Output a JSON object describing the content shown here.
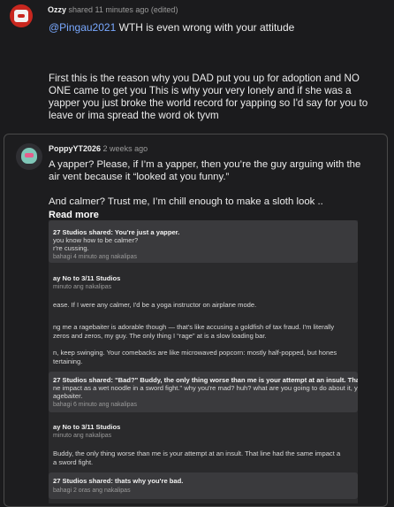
{
  "comment": {
    "username": "Ozzy",
    "shared": "shared 11 minutes ago (edited)",
    "mention": "@Pingau2021",
    "first_line": " WTH is even wrong with your attitude",
    "body_lines": [
      "First this is the reason why you DAD put you up for adoption and NO",
      "ONE came to get you This is why your very lonely and if she was a",
      "yapper you just broke the world record for yapping so I'd say for you to",
      "leave or ima spread the word ok tyvm"
    ]
  },
  "reply": {
    "username": "PoppyYT2026",
    "time": "2 weeks ago",
    "lines": [
      "A yapper? Please, if I’m a yapper, then you’re the guy arguing with the",
      "air vent because it “looked at you funny.”",
      "",
      "And calmer? Trust me, I’m chill enough to make a sloth look .."
    ],
    "read_more": "Read more",
    "screenshot": {
      "card1": [
        "27  Studios shared: You're just a yapper.",
        "you know how to be calmer?",
        "r're cussing.",
        "bahagi 4 minuto ang nakalipas"
      ],
      "reply2_header": "ay No to 3/11 Studios",
      "reply2_time": "minuto ang nakalipas",
      "reply2_lines": [
        "ease. If I were any calmer, I'd be a yoga instructor on airplane mode.",
        "",
        "ng me a ragebaiter is adorable though — that's like accusing a goldfish of tax fraud. I'm literally",
        "zeros and zeros, my guy. The only thing I “rage” at is a slow loading bar.",
        "",
        "n, keep swinging. Your comebacks are like microwaved popcorn: mostly half-popped, but hones",
        "tertaining."
      ],
      "card2": [
        "27  Studios shared: \"Bad?\" Buddy, the only thing worse than me is your attempt at an insult. That line had the",
        "ne impact as a wet noodle in a sword fight.\" why you're mad? huh? what are you going to do about it, you're",
        "agebaiter.",
        "bahagi 6 minuto ang nakalipas"
      ],
      "reply3_header": "ay No to 3/11 Studios",
      "reply3_time": "minuto ang nakalipas",
      "reply3_lines": [
        "Buddy, the only thing worse than me is your attempt at an insult. That line had the same impact a",
        "a sword fight."
      ],
      "card3": [
        "27  Studios shared: thats why you're bad.",
        "bahagi 2 oras ang nakalipas"
      ]
    }
  }
}
